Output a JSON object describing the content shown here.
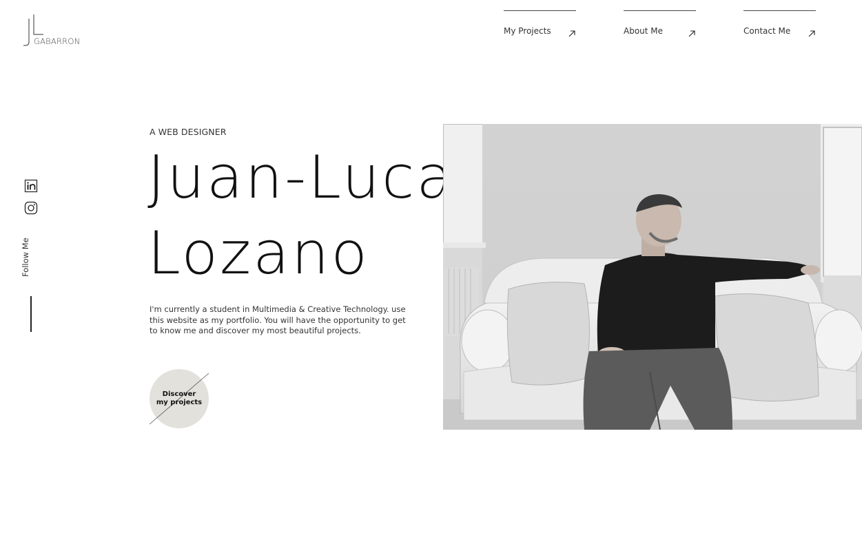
{
  "logo": {
    "monogram": "JL",
    "word": "GABARRON"
  },
  "nav": {
    "items": [
      {
        "label": "My Projects"
      },
      {
        "label": "About Me"
      },
      {
        "label": "Contact Me"
      }
    ]
  },
  "social": {
    "icons": [
      "linkedin-icon",
      "instagram-icon"
    ],
    "follow_label": "Follow Me"
  },
  "hero": {
    "eyebrow": "A WEB DESIGNER",
    "name_line1": "Juan-Luca",
    "name_line2": "Lozano",
    "intro": "I'm currently a student in Multimedia & Creative Technology. use this website as my portfolio. You will have the opportunity to get to know me and discover my most beautiful projects.",
    "cta_line1": "Discover",
    "cta_line2": "my projects"
  },
  "colors": {
    "text": "#222222",
    "cta_bg": "#e2e1dc",
    "background": "#ffffff"
  }
}
